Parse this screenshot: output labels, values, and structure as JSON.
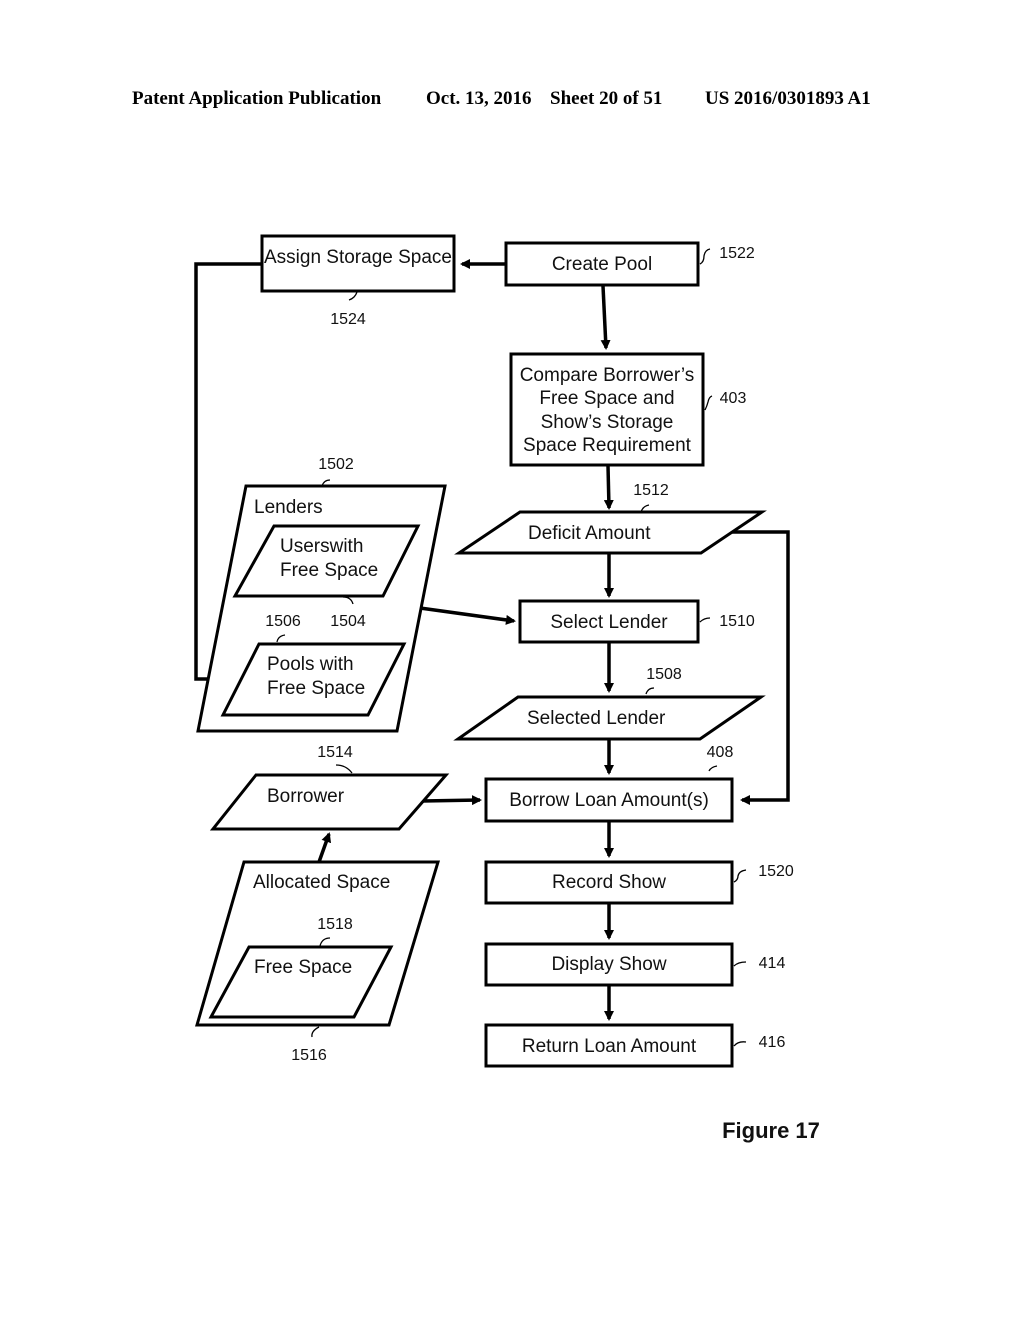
{
  "header": {
    "publication": "Patent Application Publication",
    "date": "Oct. 13, 2016",
    "sheet": "Sheet 20 of 51",
    "number": "US 2016/0301893 A1"
  },
  "figure_label": "Figure 17",
  "nodes": {
    "assign_storage": {
      "lines": [
        "Assign Storage Space"
      ],
      "ref": "1524"
    },
    "create_pool": {
      "lines": [
        "Create Pool"
      ],
      "ref": "1522"
    },
    "compare": {
      "lines": [
        "Compare Borrower’s",
        "Free Space and",
        "Show’s Storage",
        "Space Requirement"
      ],
      "ref": "403"
    },
    "lenders": {
      "lines": [
        "Lenders"
      ],
      "ref": "1502"
    },
    "users_free": {
      "lines": [
        "Userswith",
        "Free Space"
      ],
      "ref": "1504"
    },
    "pools_free": {
      "lines": [
        "Pools with",
        "Free Space"
      ],
      "ref": "1506"
    },
    "deficit": {
      "lines": [
        "Deficit Amount"
      ],
      "ref": "1512"
    },
    "select_lender": {
      "lines": [
        "Select Lender"
      ],
      "ref": "1510"
    },
    "selected_lender": {
      "lines": [
        "Selected Lender"
      ],
      "ref": "1508"
    },
    "borrower": {
      "lines": [
        "Borrower"
      ],
      "ref": "1514"
    },
    "borrow_loan": {
      "lines": [
        "Borrow Loan Amount(s)"
      ],
      "ref": "408"
    },
    "allocated": {
      "lines": [
        "Allocated Space"
      ],
      "ref": "1516"
    },
    "free_space": {
      "lines": [
        "Free Space"
      ],
      "ref": "1518"
    },
    "record_show": {
      "lines": [
        "Record Show"
      ],
      "ref": "1520"
    },
    "display_show": {
      "lines": [
        "Display Show"
      ],
      "ref": "414"
    },
    "return_loan": {
      "lines": [
        "Return Loan Amount"
      ],
      "ref": "416"
    }
  },
  "edges": [
    {
      "from": "create_pool",
      "to": "assign_storage"
    },
    {
      "from": "create_pool",
      "to": "compare"
    },
    {
      "from": "compare",
      "to": "deficit"
    },
    {
      "from": "deficit",
      "to": "select_lender"
    },
    {
      "from": "deficit",
      "to": "borrow_loan"
    },
    {
      "from": "assign_storage",
      "to": "pools_free"
    },
    {
      "from": "lenders",
      "to": "select_lender"
    },
    {
      "from": "select_lender",
      "to": "selected_lender"
    },
    {
      "from": "selected_lender",
      "to": "borrow_loan"
    },
    {
      "from": "borrower",
      "to": "borrow_loan"
    },
    {
      "from": "allocated",
      "to": "borrower"
    },
    {
      "from": "borrow_loan",
      "to": "record_show"
    },
    {
      "from": "record_show",
      "to": "display_show"
    },
    {
      "from": "display_show",
      "to": "return_loan"
    }
  ]
}
